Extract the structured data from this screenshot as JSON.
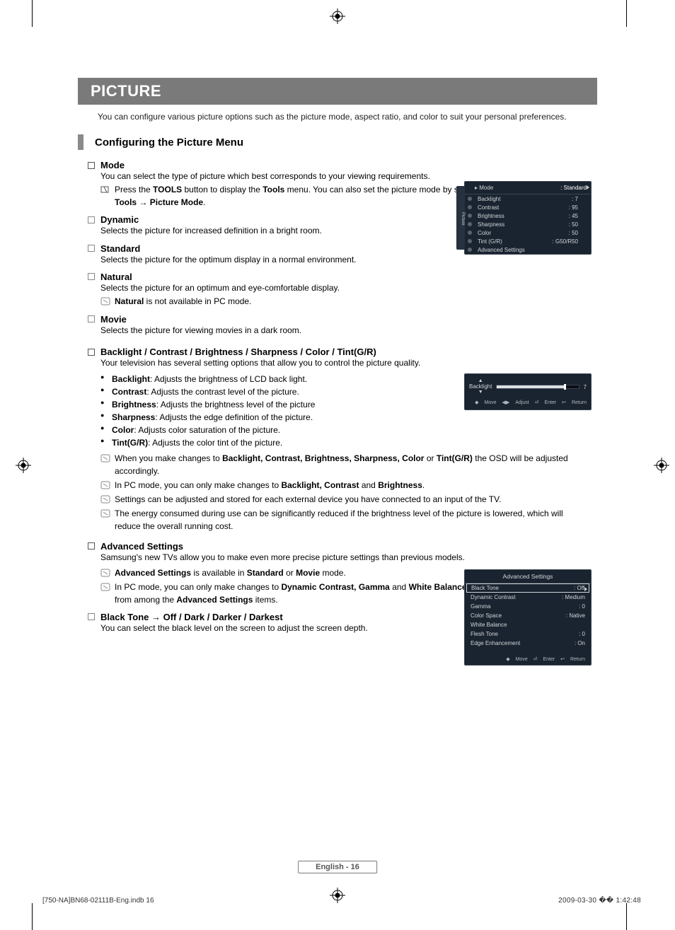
{
  "page": {
    "banner": "PICTURE",
    "intro": "You can configure various picture options such as the picture mode, aspect ratio, and color to suit your personal preferences.",
    "section_title": "Configuring the Picture Menu",
    "page_number": "English - 16",
    "footer_file": "[750-NA]BN68-02111B-Eng.indb   16",
    "footer_time": "2009-03-30   �� 1:42:48"
  },
  "mode": {
    "title": "Mode",
    "desc": "You can select the type of picture which best corresponds to your viewing requirements.",
    "tools_pre": "Press the ",
    "tools_b1": "TOOLS",
    "tools_mid": " button to display the ",
    "tools_b2": "Tools",
    "tools_mid2": " menu. You can also set the picture mode by selecting ",
    "tools_b3": "Tools → Picture Mode",
    "tools_end": ".",
    "items": [
      {
        "name": "Dynamic",
        "desc": "Selects the picture for increased definition in a bright room."
      },
      {
        "name": "Standard",
        "desc": "Selects the picture for the optimum display in a normal environment."
      },
      {
        "name": "Natural",
        "desc": "Selects the picture for an optimum and eye-comfortable display.",
        "note_b": "Natural",
        "note": " is not available in PC mode."
      },
      {
        "name": "Movie",
        "desc": "Selects the picture for viewing movies in a dark room."
      }
    ]
  },
  "adjust": {
    "title": "Backlight / Contrast / Brightness / Sharpness / Color / Tint(G/R)",
    "desc": "Your television has several setting options that allow you to control the picture quality.",
    "bullets": [
      {
        "b": "Backlight",
        "t": ": Adjusts the brightness of LCD back light."
      },
      {
        "b": "Contrast",
        "t": ": Adjusts the contrast level of the picture."
      },
      {
        "b": "Brightness",
        "t": ": Adjusts the brightness level of the picture"
      },
      {
        "b": "Sharpness",
        "t": ": Adjusts the edge definition of the picture."
      },
      {
        "b": "Color",
        "t": ": Adjusts color saturation of the picture."
      },
      {
        "b": "Tint(G/R)",
        "t": ": Adjusts the color tint of the picture."
      }
    ],
    "notes": [
      {
        "pre": "When you make changes to ",
        "b": "Backlight, Contrast, Brightness, Sharpness, Color",
        "mid": " or ",
        "b2": "Tint(G/R)",
        "post": " the OSD will be adjusted accordingly."
      },
      {
        "pre": "In PC mode, you can only make changes to ",
        "b": "Backlight, Contrast",
        "mid": " and ",
        "b2": "Brightness",
        "post": "."
      },
      {
        "plain": "Settings can be adjusted and stored for each external device you have connected to an input of the TV."
      },
      {
        "plain": "The energy consumed during use can be significantly reduced if the brightness level of the picture is lowered, which will reduce the overall running cost."
      }
    ]
  },
  "advanced": {
    "title": "Advanced Settings",
    "desc": "Samsung's new TVs allow you to make even more precise picture settings than previous models.",
    "note1_b1": "Advanced Settings",
    "note1_mid": " is available in ",
    "note1_b2": "Standard",
    "note1_mid2": " or ",
    "note1_b3": "Movie",
    "note1_end": " mode.",
    "note2_pre": "In PC mode, you can only make changes to ",
    "note2_b1": "Dynamic Contrast, Gamma",
    "note2_mid": " and ",
    "note2_b2": "White Balance",
    "note2_mid2": " from among the ",
    "note2_b3": "Advanced Settings",
    "note2_end": " items.",
    "blacktone_title": "Black Tone → Off / Dark / Darker / Darkest",
    "blacktone_desc": "You can select the black level on the screen to adjust the screen depth."
  },
  "osd1": {
    "side": "Picture",
    "mode_label": "Mode",
    "mode_value": ": Standard",
    "rows": [
      {
        "k": "Backlight",
        "v": ": 7"
      },
      {
        "k": "Contrast",
        "v": ": 95"
      },
      {
        "k": "Brightness",
        "v": ": 45"
      },
      {
        "k": "Sharpness",
        "v": ": 50"
      },
      {
        "k": "Color",
        "v": ": 50"
      },
      {
        "k": "Tint (G/R)",
        "v": ": G50/R50"
      },
      {
        "k": "Advanced Settings",
        "v": ""
      }
    ]
  },
  "osd2": {
    "label": "Backlight",
    "value": "7",
    "footer": {
      "move": "Move",
      "adjust": "Adjust",
      "enter": "Enter",
      "return": "Return"
    },
    "arr_up": "▲",
    "arr_down": "▼"
  },
  "osd3": {
    "title": "Advanced Settings",
    "rows": [
      {
        "k": "Black Tone",
        "v": ": Off",
        "sel": true
      },
      {
        "k": "Dynamic Contrast",
        "v": ": Medium"
      },
      {
        "k": "Gamma",
        "v": ": 0"
      },
      {
        "k": "Color Space",
        "v": ": Native"
      },
      {
        "k": "White Balance",
        "v": ""
      },
      {
        "k": "Flesh Tone",
        "v": ": 0"
      },
      {
        "k": "Edge Enhancement",
        "v": ": On"
      }
    ],
    "footer": {
      "move": "Move",
      "enter": "Enter",
      "return": "Return"
    }
  },
  "glyph": {
    "up": "▲",
    "down": "▼",
    "updown": "◆",
    "lr": "◀▶",
    "enter": "⏎",
    "return": "↩"
  }
}
